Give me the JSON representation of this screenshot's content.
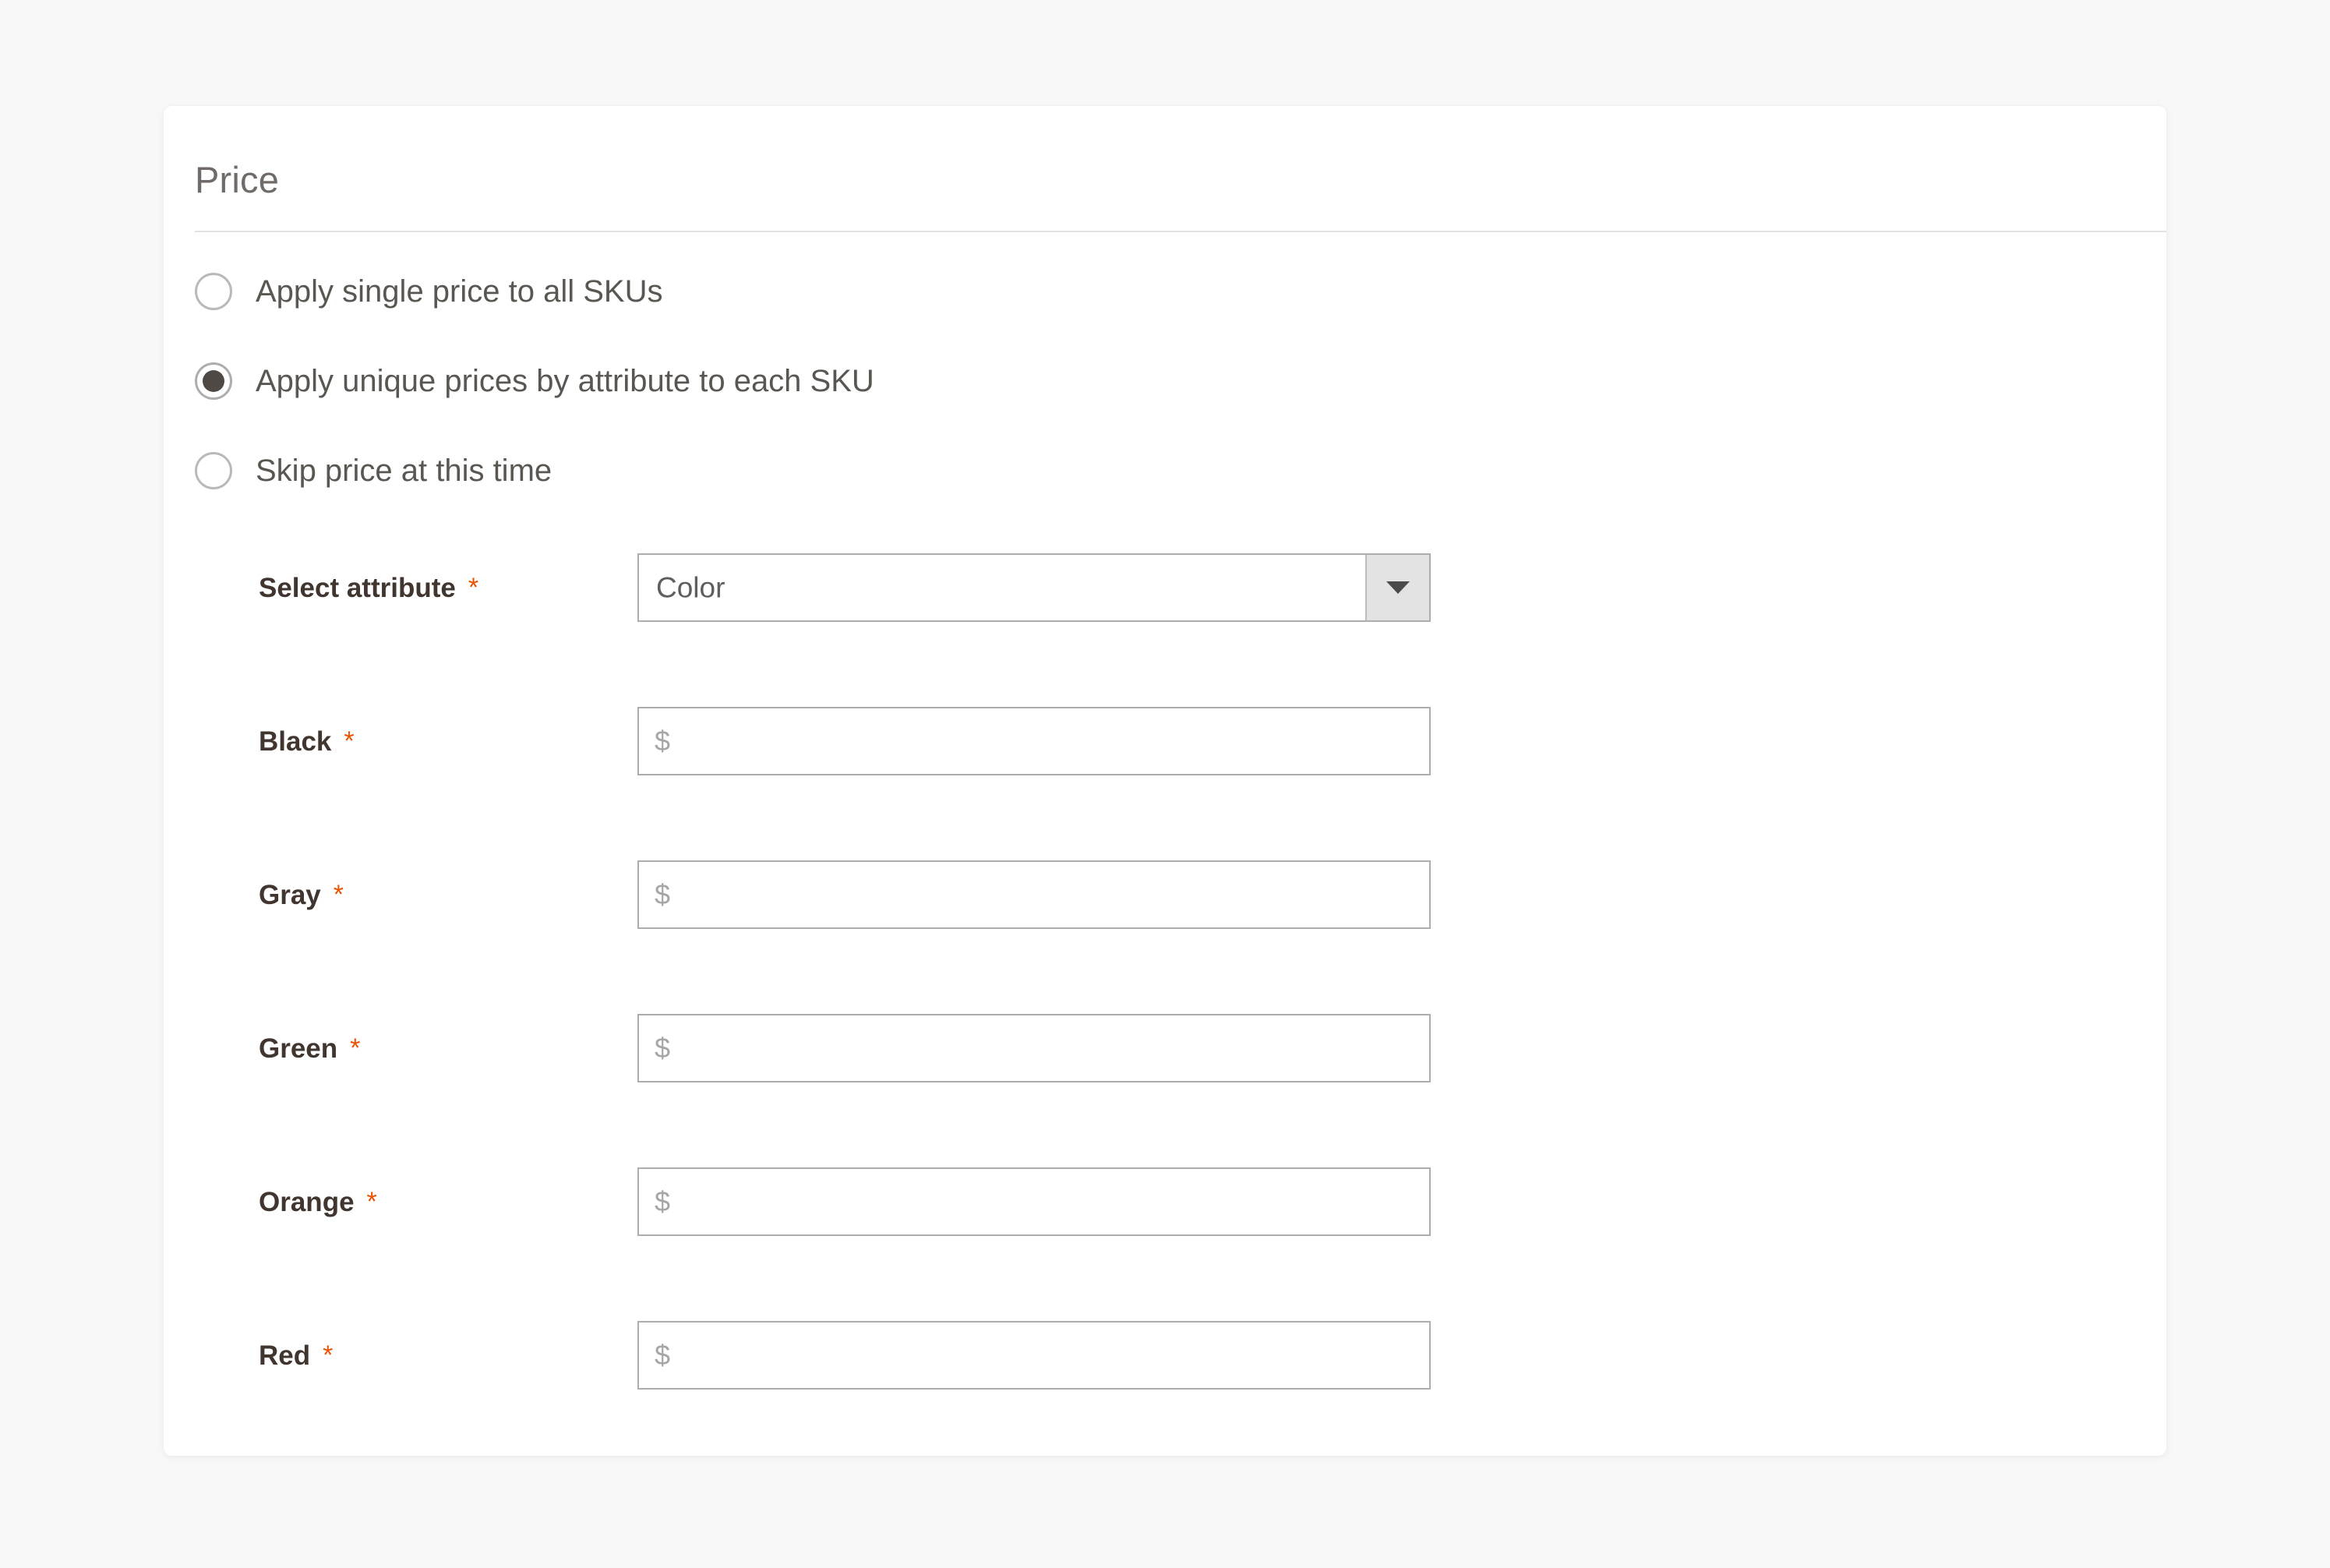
{
  "panel": {
    "title": "Price"
  },
  "price_mode": {
    "options": [
      {
        "label": "Apply single price to all SKUs",
        "selected": false
      },
      {
        "label": "Apply unique prices by attribute to each SKU",
        "selected": true
      },
      {
        "label": "Skip price at this time",
        "selected": false
      }
    ]
  },
  "attribute_row": {
    "label": "Select attribute",
    "required_marker": "*",
    "selected_value": "Color",
    "caret_icon": "chevron-down-icon"
  },
  "price_fields": [
    {
      "label": "Black",
      "required_marker": "*",
      "currency_symbol": "$",
      "value": "",
      "placeholder": ""
    },
    {
      "label": "Gray",
      "required_marker": "*",
      "currency_symbol": "$",
      "value": "",
      "placeholder": ""
    },
    {
      "label": "Green",
      "required_marker": "*",
      "currency_symbol": "$",
      "value": "",
      "placeholder": ""
    },
    {
      "label": "Orange",
      "required_marker": "*",
      "currency_symbol": "$",
      "value": "",
      "placeholder": ""
    },
    {
      "label": "Red",
      "required_marker": "*",
      "currency_symbol": "$",
      "value": "",
      "placeholder": ""
    }
  ],
  "colors": {
    "page_background": "#f8f8f8",
    "panel_background": "#ffffff",
    "title_text": "#706b68",
    "label_text": "#41362f",
    "required_marker": "#eb5202",
    "radio_selected_dot": "#4e4945",
    "input_border": "#adadad",
    "divider": "#e3e3e3"
  }
}
